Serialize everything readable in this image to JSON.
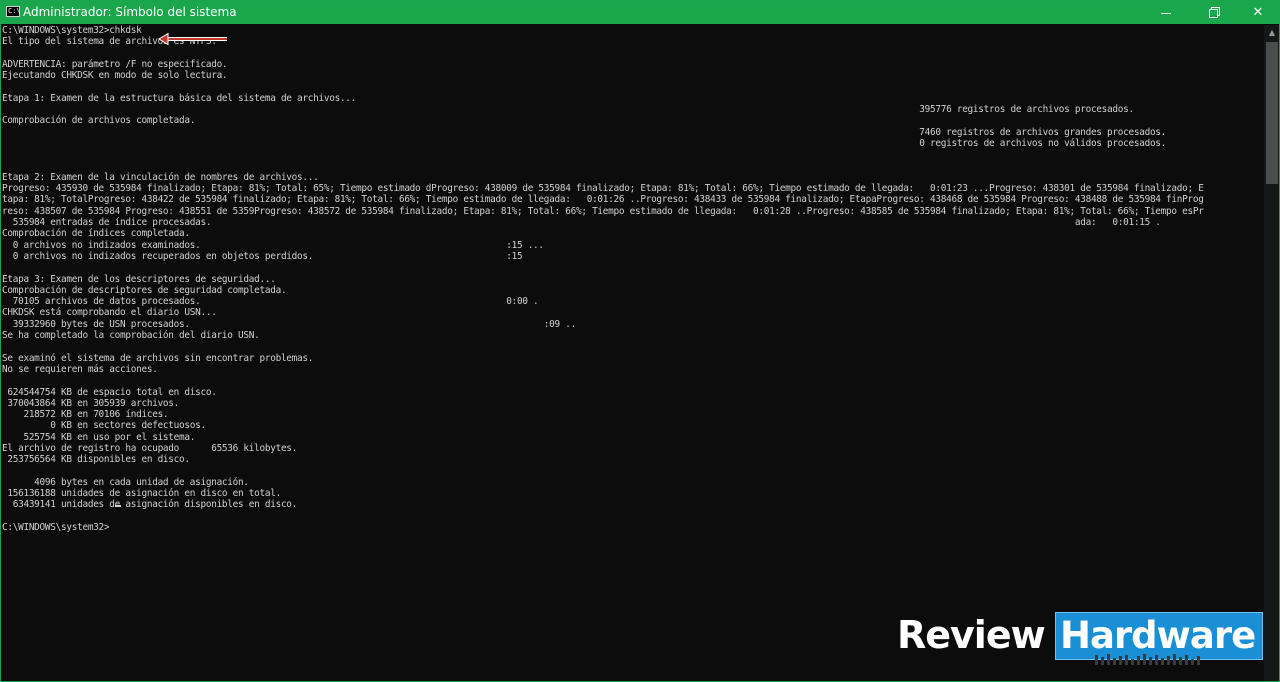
{
  "window": {
    "title": "Administrador: Símbolo del sistema",
    "icon": "console-icon",
    "icon_glyph": "C:\\",
    "frame_color": "#1aa64a",
    "controls": {
      "minimize_icon": "minimize-icon",
      "maximize_icon": "restore-icon",
      "close_glyph": "✕"
    }
  },
  "console": {
    "text_color": "#d0d0d0",
    "background": "#0c0c0c",
    "output": "C:\\WINDOWS\\system32>chkdsk\nEl tipo del sistema de archivos es NTFS.\n\nADVERTENCIA: parámetro /F no especificado.\nEjecutando CHKDSK en modo de solo lectura.\n\nEtapa 1: Examen de la estructura básica del sistema de archivos...\n                                                                                                                                                                           395776 registros de archivos procesados.\nComprobación de archivos completada.\n                                                                                                                                                                           7460 registros de archivos grandes procesados.\n                                                                                                                                                                           0 registros de archivos no válidos procesados.\n\n\nEtapa 2: Examen de la vinculación de nombres de archivos...\nProgreso: 435930 de 535984 finalizado; Etapa: 81%; Total: 65%; Tiempo estimado dProgreso: 438009 de 535984 finalizado; Etapa: 81%; Total: 66%; Tiempo estimado de llegada:   0:01:23 ...Progreso: 438301 de 535984 finalizado; E\ntapa: 81%; TotalProgreso: 438422 de 535984 finalizado; Etapa: 81%; Total: 66%; Tiempo estimado de llegada:   0:01:26 ..Progreso: 438433 de 535984 finalizado; EtapaProgreso: 438468 de 535984 Progreso: 438488 de 535984 finProg\nreso: 438507 de 535984 Progreso: 438551 de 5359Progreso: 438572 de 535984 finalizado; Etapa: 81%; Total: 66%; Tiempo estimado de llegada:   0:01:28 ..Progreso: 438585 de 535984 finalizado; Etapa: 81%; Total: 66%; Tiempo esPr\n  535984 entradas de índice procesadas.                                                                                                                                                                 ada:   0:01:15 .\nComprobación de índices completada.\n  0 archivos no indizados examinados.                                                         :15 ...\n  0 archivos no indizados recuperados en objetos perdidos.                                    :15\n\nEtapa 3: Examen de los descriptores de seguridad...\nComprobación de descriptores de seguridad completada.\n  70105 archivos de datos procesados.                                                         0:00 .\nCHKDSK está comprobando el diario USN...\n  39332960 bytes de USN procesados.                                                                  :09 ..\nSe ha completado la comprobación del diario USN.\n\nSe examinó el sistema de archivos sin encontrar problemas.\nNo se requieren más acciones.\n\n 624544754 KB de espacio total en disco.\n 370043864 KB en 305939 archivos.\n    218572 KB en 70106 índices.\n         0 KB en sectores defectuosos.\n    525754 KB en uso por el sistema.\nEl archivo de registro ha ocupado      65536 kilobytes.\n 253756564 KB disponibles en disco.\n\n      4096 bytes en cada unidad de asignación.\n 156136188 unidades de asignación en disco en total.\n  63439141 unidades de asignación disponibles en disco.\n\nC:\\WINDOWS\\system32>"
  },
  "annotation": {
    "type": "red-arrow-icon",
    "color": "#c0392b"
  },
  "scrollbar": {
    "up_glyph": "▲"
  },
  "watermark": {
    "word1": "Review",
    "word2": "Hardware",
    "box_color": "#1a8fd6",
    "logo_icon": "circuit-icon"
  }
}
